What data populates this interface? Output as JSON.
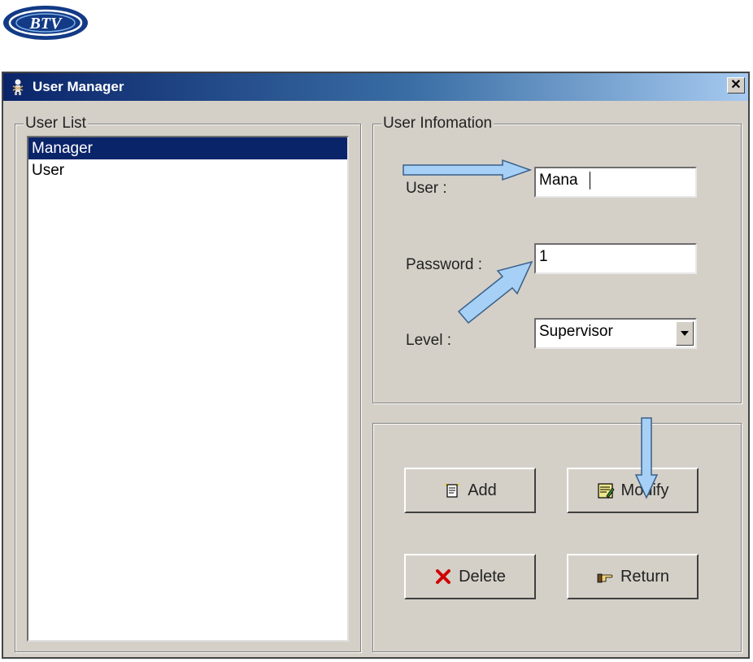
{
  "window": {
    "title": "User Manager",
    "close_label": "✕"
  },
  "logo": {
    "text": "BTV"
  },
  "user_list": {
    "group_label": "User List",
    "items": [
      "Manager",
      "User"
    ],
    "selected": "Manager"
  },
  "user_info": {
    "group_label": "User Infomation",
    "user_label": "User :",
    "user_value": "Mana",
    "password_label": "Password :",
    "password_value": "1",
    "level_label": "Level :",
    "level_value": "Supervisor"
  },
  "buttons": {
    "add": "Add",
    "modify": "Modify",
    "delete": "Delete",
    "return": "Return"
  },
  "colors": {
    "title_bar": "#0a246a",
    "selection": "#0a246a",
    "annotation_arrow": "#a6d0f5"
  }
}
